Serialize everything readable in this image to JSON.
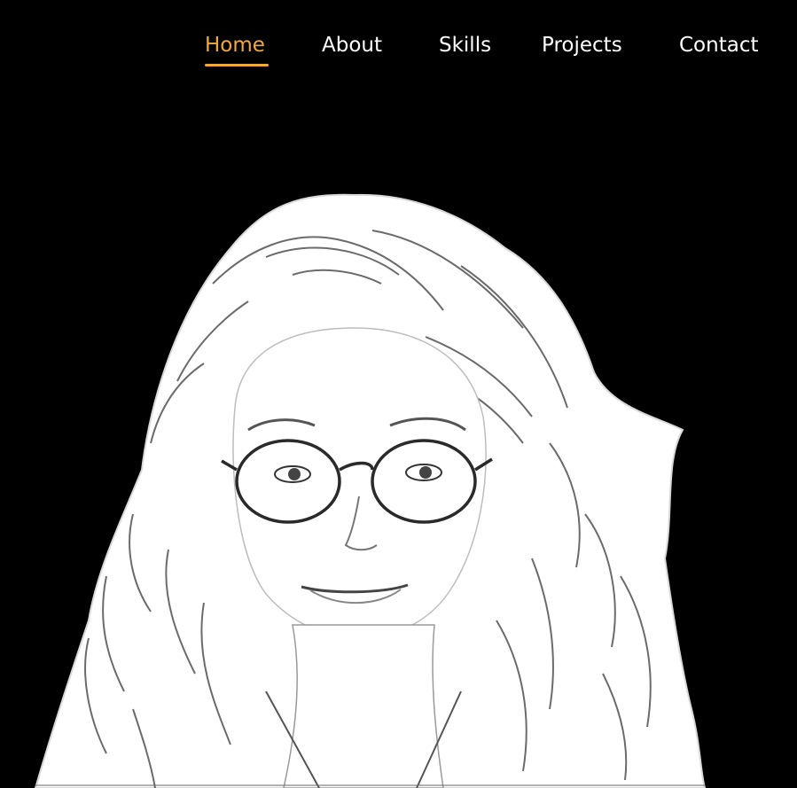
{
  "nav": {
    "items": [
      {
        "label": "Home",
        "active": true
      },
      {
        "label": "About",
        "active": false
      },
      {
        "label": "Skills",
        "active": false
      },
      {
        "label": "Projects",
        "active": false
      },
      {
        "label": "Contact",
        "active": false
      }
    ]
  },
  "colors": {
    "background": "#000000",
    "nav_text": "#ffffff",
    "accent": "#f2a93b",
    "sketch_fill": "#ffffff",
    "sketch_lines": "#2a2a2a"
  },
  "hero": {
    "image": "pencil-sketch portrait of a woman with curly hair and round glasses"
  }
}
